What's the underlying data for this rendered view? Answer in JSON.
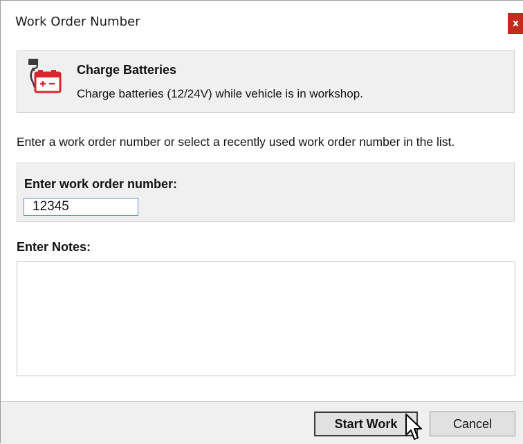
{
  "window": {
    "title": "Work Order Number",
    "close_label": "x"
  },
  "task": {
    "icon": "battery-charge-icon",
    "title": "Charge Batteries",
    "description": "Charge batteries (12/24V) while vehicle is in workshop."
  },
  "instruction": "Enter a work order number or select a recently used work order number in the list.",
  "work_order": {
    "label": "Enter work order number:",
    "value": "12345"
  },
  "notes": {
    "label": "Enter Notes:",
    "value": ""
  },
  "buttons": {
    "start_label": "Start Work",
    "cancel_label": "Cancel"
  },
  "colors": {
    "close_button": "#c42b1c",
    "icon_red": "#d9262c",
    "input_border": "#5a8fd4",
    "panel_background": "#f0f0f0"
  }
}
